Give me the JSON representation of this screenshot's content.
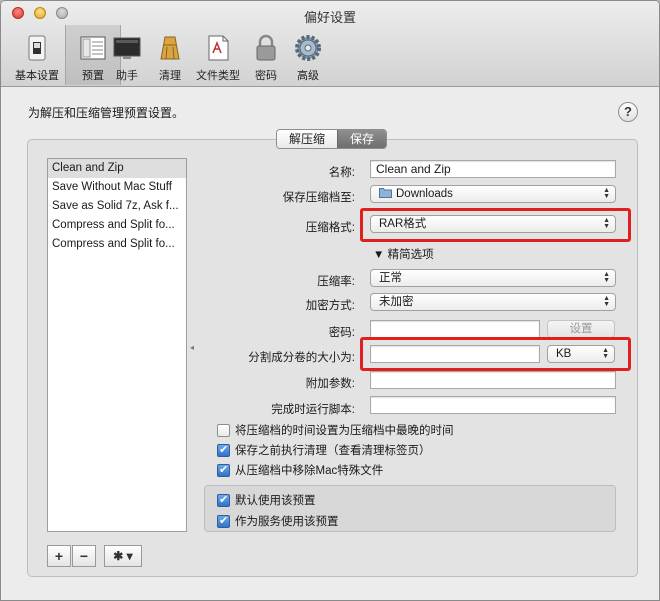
{
  "window": {
    "title": "偏好设置"
  },
  "toolbar": {
    "items": [
      {
        "label": "基本设置",
        "icon": "switch-icon"
      },
      {
        "label": "预置",
        "icon": "presets-icon"
      },
      {
        "label": "助手",
        "icon": "monitor-icon"
      },
      {
        "label": "清理",
        "icon": "broom-icon"
      },
      {
        "label": "文件类型",
        "icon": "document-icon"
      },
      {
        "label": "密码",
        "icon": "lock-icon"
      },
      {
        "label": "高级",
        "icon": "gear-icon"
      }
    ],
    "active_index": 1
  },
  "intro": "为解压和压缩管理预置设置。",
  "help_label": "?",
  "segments": {
    "left": "解压缩",
    "right": "保存",
    "selected": "保存"
  },
  "presets": {
    "items": [
      "Clean and Zip",
      "Save Without Mac Stuff",
      "Save as Solid 7z, Ask f...",
      "Compress and Split fo...",
      "Compress and Split fo..."
    ],
    "selected_index": 0
  },
  "list_buttons": {
    "add": "+",
    "remove": "−",
    "gear": "✱ ▾"
  },
  "form": {
    "name_label": "名称:",
    "name_value": "Clean and Zip",
    "save_to_label": "保存压缩档至:",
    "save_to_value": "Downloads",
    "format_label": "压缩格式:",
    "format_value": "RAR格式",
    "options_toggle": "▼ 精简选项",
    "ratio_label": "压缩率:",
    "ratio_value": "正常",
    "encrypt_label": "加密方式:",
    "encrypt_value": "未加密",
    "password_label": "密码:",
    "password_value": "",
    "set_button": "设置",
    "split_label": "分割成分卷的大小为:",
    "split_value": "",
    "split_unit": "KB",
    "extra_label": "附加参数:",
    "extra_value": "",
    "script_label": "完成时运行脚本:",
    "script_value": ""
  },
  "checkboxes": [
    {
      "label": "将压缩档的时间设置为压缩档中最晚的时间",
      "checked": false
    },
    {
      "label": "保存之前执行清理（查看清理标签页）",
      "checked": true
    },
    {
      "label": "从压缩档中移除Mac特殊文件",
      "checked": true
    }
  ],
  "defaults": [
    {
      "label": "默认使用该预置",
      "checked": true
    },
    {
      "label": "作为服务使用该预置",
      "checked": true
    }
  ],
  "colors": {
    "highlight": "#e0201e",
    "checkbox_accent": "#2f73c8"
  }
}
